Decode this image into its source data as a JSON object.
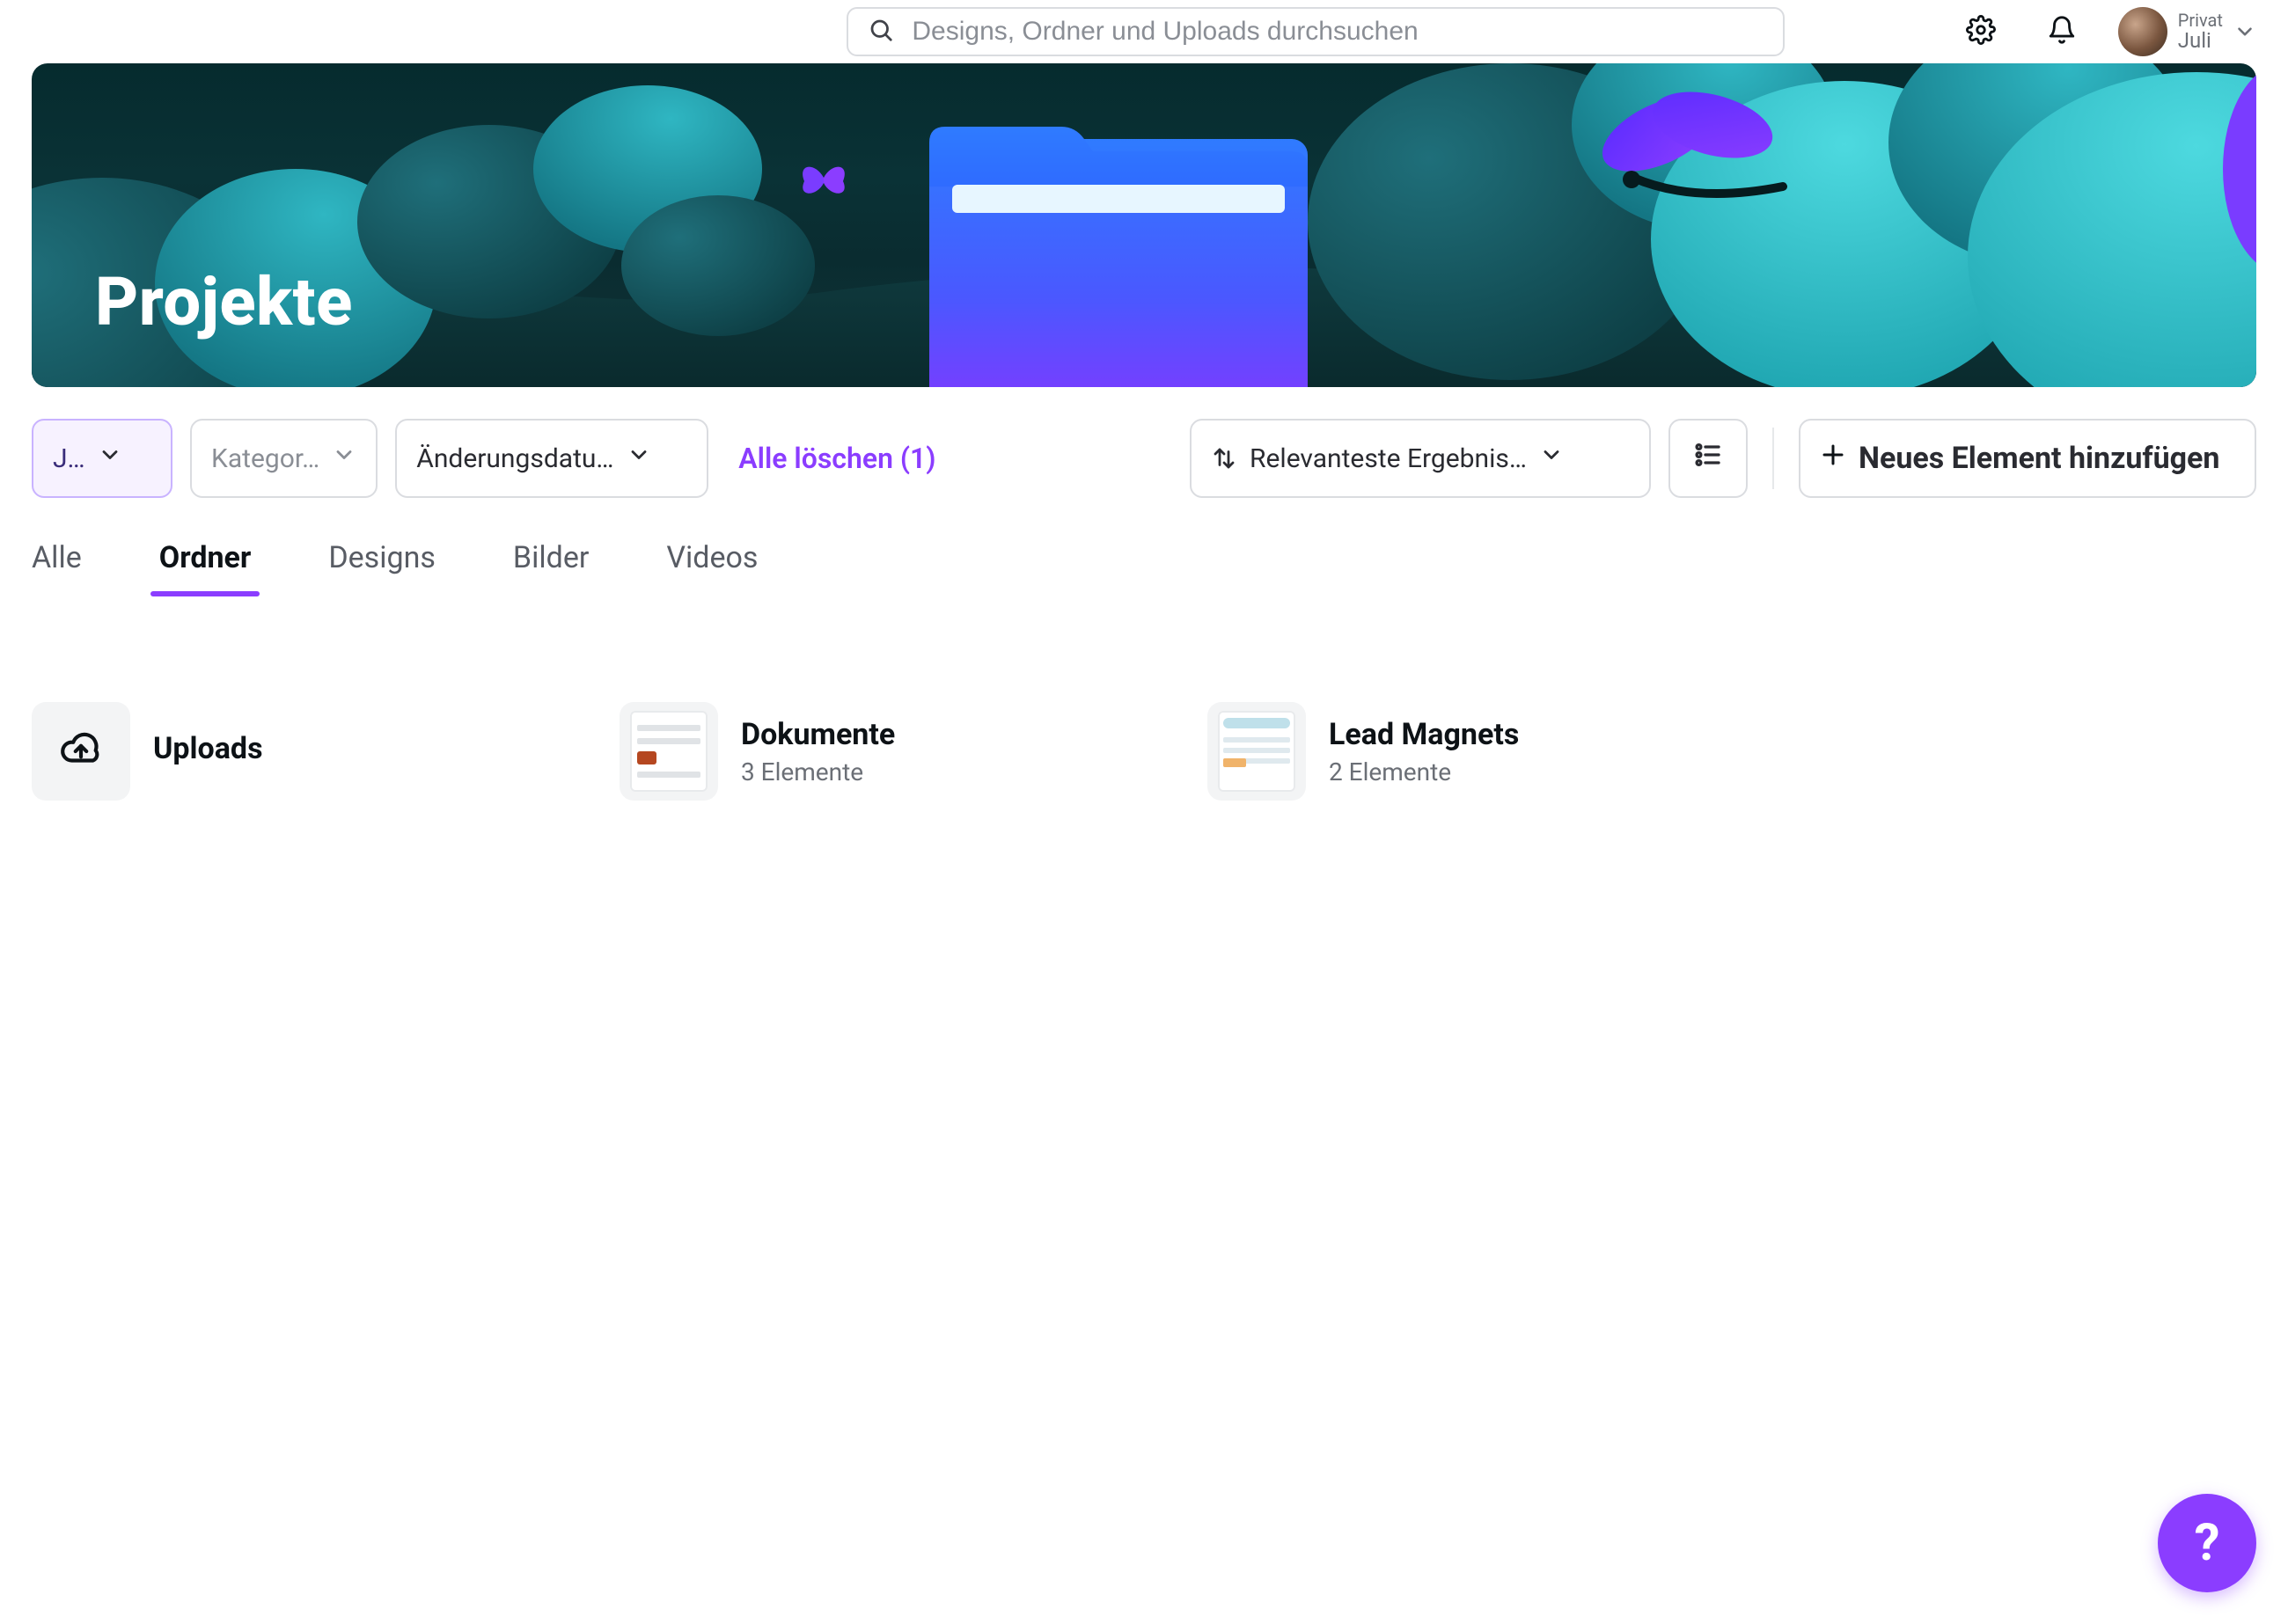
{
  "search": {
    "placeholder": "Designs, Ordner und Uploads durchsuchen"
  },
  "account": {
    "line1": "Privat",
    "line2": "Juli"
  },
  "banner": {
    "title": "Projekte"
  },
  "filters": {
    "owner_label": "J…",
    "category_label": "Kategor…",
    "date_label": "Änderungsdatu…",
    "clear_label": "Alle löschen (1)",
    "sort_label": "Relevanteste Ergebnis…",
    "add_label": "Neues Element hinzufügen"
  },
  "tabs": [
    {
      "id": "alle",
      "label": "Alle"
    },
    {
      "id": "ordner",
      "label": "Ordner"
    },
    {
      "id": "designs",
      "label": "Designs"
    },
    {
      "id": "bilder",
      "label": "Bilder"
    },
    {
      "id": "videos",
      "label": "Videos"
    }
  ],
  "active_tab": "ordner",
  "folders": [
    {
      "id": "uploads",
      "name": "Uploads",
      "sub": "",
      "thumb": "cloud"
    },
    {
      "id": "dokumente",
      "name": "Dokumente",
      "sub": "3 Elemente",
      "thumb": "doc"
    },
    {
      "id": "lead",
      "name": "Lead Magnets",
      "sub": "2 Elemente",
      "thumb": "sheet"
    }
  ],
  "fab": {
    "label": "?"
  }
}
